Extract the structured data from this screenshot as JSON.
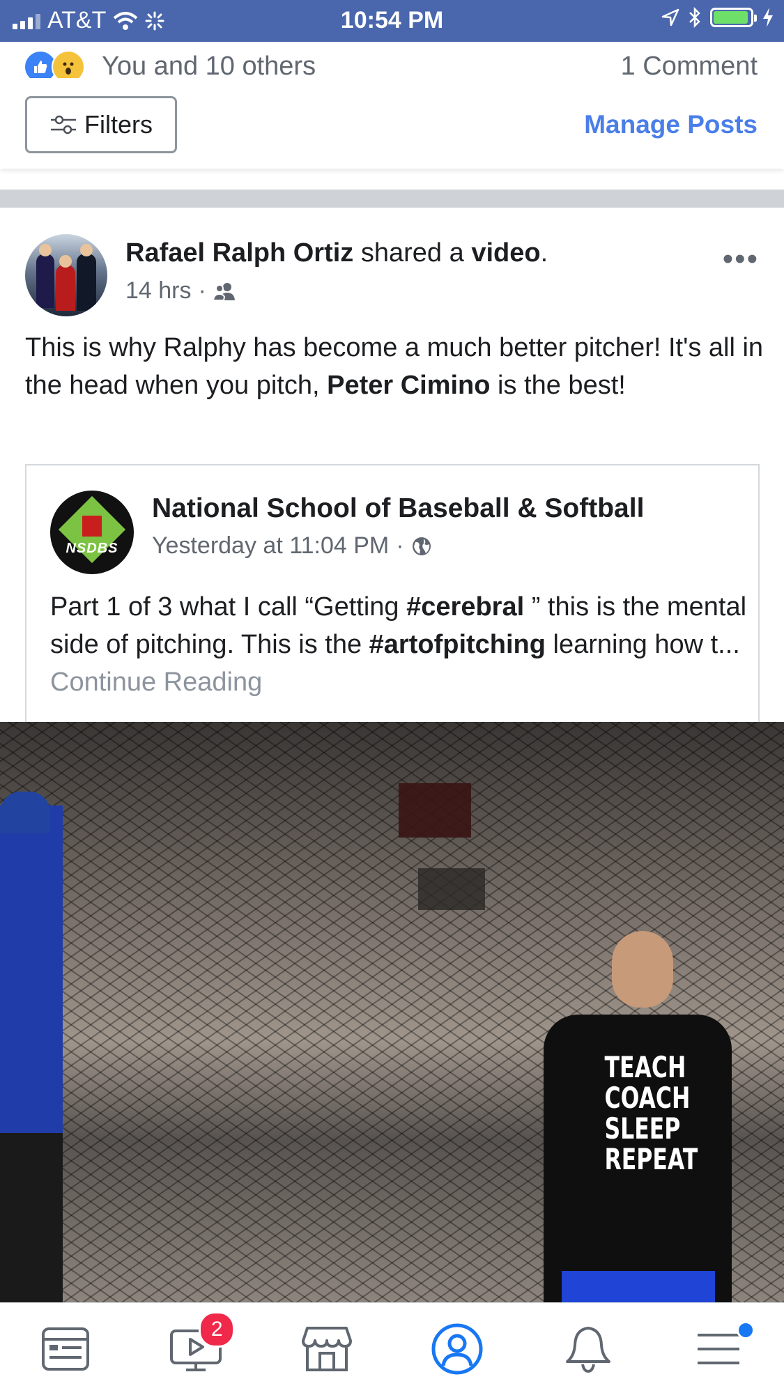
{
  "status_bar": {
    "carrier": "AT&T",
    "time": "10:54 PM"
  },
  "reactions": {
    "text": "You and 10 others",
    "comments": "1 Comment"
  },
  "filters_bar": {
    "filters_label": "Filters",
    "manage_posts_label": "Manage Posts"
  },
  "post": {
    "author": "Rafael Ralph Ortiz",
    "action_prefix": "shared a",
    "action_object": "video",
    "action_suffix": ".",
    "time": "14 hrs",
    "separator": "·",
    "audience_icon": "friends-icon",
    "text_part1": "This is why Ralphy has become a much better pitcher! It's all in the head when you pitch,",
    "mention": "Peter Cimino",
    "text_part2": "is the best!"
  },
  "shared": {
    "page_name": "National School of Baseball & Softball",
    "logo_text": "NSDBS",
    "time": "Yesterday at 11:04 PM",
    "separator": "·",
    "audience_icon": "globe-icon",
    "text_a": "Part 1 of 3 what I call “Getting",
    "hashtag1": "#cerebral",
    "text_b": "” this is the mental side of pitching. This is the",
    "hashtag2": "#artofpitching",
    "text_c": "learning how t...",
    "continue": "Continue Reading"
  },
  "video": {
    "shirt_text": "TEACH COACH SLEEP REPEAT"
  },
  "tab_bar": {
    "items": [
      {
        "name": "news-feed",
        "icon": "news-feed-icon",
        "active": false
      },
      {
        "name": "watch",
        "icon": "video-icon",
        "badge": "2",
        "active": false
      },
      {
        "name": "marketplace",
        "icon": "marketplace-icon",
        "active": false
      },
      {
        "name": "profile",
        "icon": "profile-icon",
        "active": true
      },
      {
        "name": "notifications",
        "icon": "bell-icon",
        "active": false
      },
      {
        "name": "menu",
        "icon": "menu-icon",
        "active": false
      }
    ]
  },
  "colors": {
    "status_bar": "#4a67ad",
    "link": "#4a7ee8",
    "active_tab": "#1877f2",
    "badge": "#f02849"
  }
}
